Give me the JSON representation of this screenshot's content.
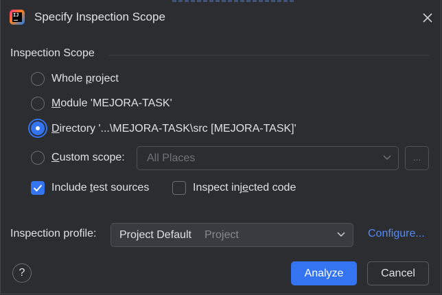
{
  "window": {
    "title": "Specify Inspection Scope"
  },
  "scope": {
    "section_label": "Inspection Scope",
    "options": {
      "whole_project": {
        "pre": "Whole ",
        "mnemonic": "p",
        "post": "roject",
        "selected": false
      },
      "module": {
        "pre": "",
        "mnemonic": "M",
        "post": "odule 'MEJORA-TASK'",
        "selected": false
      },
      "directory": {
        "pre": "",
        "mnemonic": "D",
        "post": "irectory '...\\MEJORA-TASK\\src [MEJORA-TASK]'",
        "selected": true
      },
      "custom": {
        "pre": "",
        "mnemonic": "C",
        "post": "ustom scope:",
        "selected": false
      }
    },
    "custom_scope_value": "All Places",
    "browse_label": "...",
    "include_tests": {
      "pre": "Include ",
      "mnemonic": "t",
      "post": "est sources",
      "checked": true
    },
    "inspect_injected": {
      "pre": "Inspect inj",
      "mnemonic": "e",
      "post": "cted code",
      "checked": false
    }
  },
  "profile": {
    "label": "Inspection profile:",
    "value": "Project Default",
    "sub": "Project",
    "configure_label": "Configure..."
  },
  "footer": {
    "help_glyph": "?",
    "analyze_label": "Analyze",
    "cancel_label": "Cancel"
  },
  "colors": {
    "accent": "#3574f0",
    "link": "#548af7",
    "background": "#2b2d30"
  }
}
